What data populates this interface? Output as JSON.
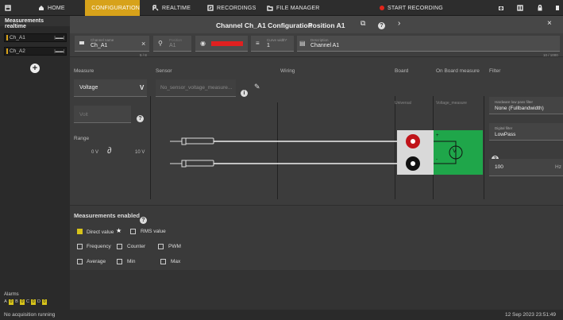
{
  "topbar": {
    "home": "HOME",
    "configuration": "CONFIGURATION",
    "realtime": "REALTIME",
    "recordings": "RECORDINGS",
    "file_manager": "FILE MANAGER",
    "start_recording": "START RECORDING"
  },
  "sidebar": {
    "title": "Measurements realtime",
    "channels": [
      {
        "label": "Ch_A1"
      },
      {
        "label": "Ch_A2"
      }
    ],
    "alarms_label": "Alarms",
    "alarm_letters": [
      "A",
      "0",
      "B",
      "0",
      "C",
      "0",
      "D",
      "0"
    ]
  },
  "header": {
    "title": "Channel Ch_A1 Configuration",
    "position": "Position A1"
  },
  "fields": {
    "channel_name_label": "Channel name",
    "channel_name": "Ch_A1",
    "channel_name_counter": "5 / 8",
    "position_label": "Position",
    "position": "A1",
    "curve_width_label": "Curve width*",
    "curve_width": "1",
    "description_label": "Description",
    "description": "Channel A1",
    "description_counter": "10 / 1000",
    "color": "#e02020"
  },
  "columns": {
    "measure": "Measure",
    "sensor": "Sensor",
    "wiring": "Wiring",
    "board": "Board",
    "on_board_measure": "On Board measure",
    "filter": "Filter"
  },
  "measure": {
    "type": "Voltage",
    "unit_short": "V",
    "unit_placeholder": "Volt",
    "range_label": "Range",
    "range_min": "0 V",
    "range_max": "10 V"
  },
  "sensor": {
    "value": "No_sensor_voltage_measure..."
  },
  "board": {
    "universal": "Universal",
    "voltage_measure": "Voltage_measure",
    "meter_symbol": "V",
    "plus": "+",
    "minus": "-"
  },
  "filter": {
    "hw_label": "Hardware low pass filter",
    "hw_value": "None (Fullbandwidth)",
    "digital_label": "Digital filter",
    "digital_value": "LowPass",
    "freq_value": "100",
    "freq_unit": "Hz"
  },
  "measurements_enabled": {
    "title": "Measurements enabled",
    "items": [
      {
        "label": "Direct value",
        "checked": true
      },
      {
        "label": "RMS value",
        "checked": false
      },
      {
        "label": "Frequency",
        "checked": false
      },
      {
        "label": "Counter",
        "checked": false
      },
      {
        "label": "PWM",
        "checked": false
      },
      {
        "label": "Average",
        "checked": false
      },
      {
        "label": "Min",
        "checked": false
      },
      {
        "label": "Max",
        "checked": false
      }
    ]
  },
  "status": {
    "acquisition": "No acquisition running",
    "datetime": "12 Sep 2023 23:51:49"
  },
  "colors": {
    "accent": "#d7a21a",
    "record": "#e2251b",
    "board_green": "#1fa64a"
  }
}
